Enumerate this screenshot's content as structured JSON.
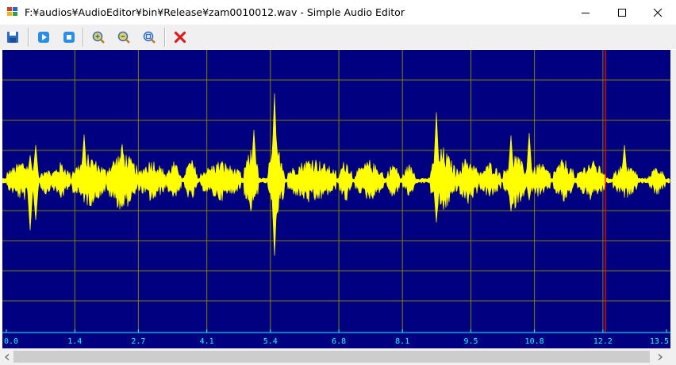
{
  "window": {
    "title": "F:¥audios¥AudioEditor¥bin¥Release¥zam0010012.wav - Simple Audio Editor",
    "controls": [
      "minimize",
      "maximize",
      "close"
    ]
  },
  "toolbar": {
    "buttons": [
      {
        "name": "save",
        "icon": "save-icon"
      },
      {
        "name": "play",
        "icon": "play-icon"
      },
      {
        "name": "stop",
        "icon": "stop-icon"
      },
      {
        "name": "zoom-in",
        "icon": "zoom-in-icon"
      },
      {
        "name": "zoom-out",
        "icon": "zoom-out-icon"
      },
      {
        "name": "zoom-fit",
        "icon": "zoom-fit-icon"
      },
      {
        "name": "close-file",
        "icon": "red-x-icon"
      }
    ]
  },
  "waveform": {
    "background_color": "#000080",
    "wave_color": "#ffff00",
    "grid_color": "#808000",
    "cursor_color": "#ff0000",
    "axis_label_color": "#00ffff",
    "time_labels": [
      "0.0",
      "1.4",
      "2.7",
      "4.1",
      "5.4",
      "6.8",
      "8.1",
      "9.5",
      "10.8",
      "12.2",
      "13.5"
    ],
    "cursor_time": 12.25
  }
}
